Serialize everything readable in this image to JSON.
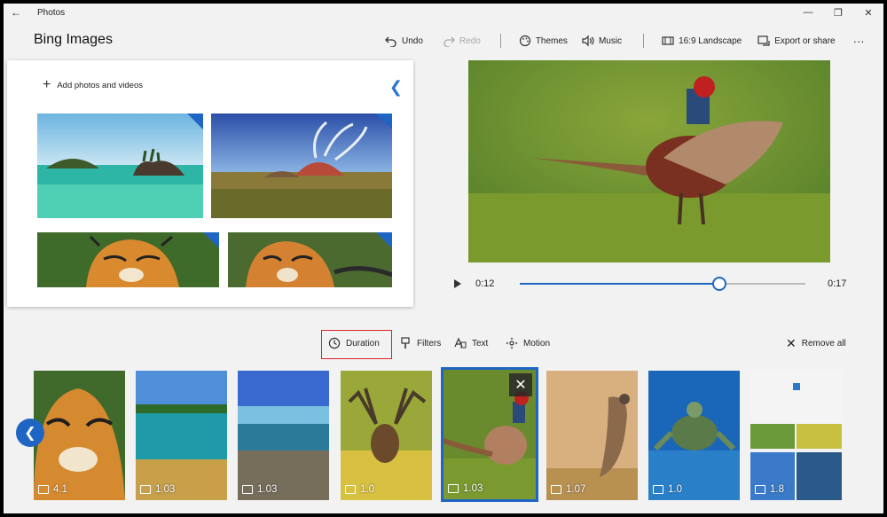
{
  "window": {
    "title": "Photos",
    "project_name": "Bing Images"
  },
  "toolbar": {
    "undo": "Undo",
    "redo": "Redo",
    "themes": "Themes",
    "music": "Music",
    "aspect": "16:9 Landscape",
    "export": "Export or share",
    "more": "···"
  },
  "library": {
    "add_label": "Add photos and videos"
  },
  "player": {
    "current_time": "0:12",
    "end_time": "0:17",
    "progress": 0.7
  },
  "storyboard": {
    "duration": "Duration",
    "filters": "Filters",
    "text": "Text",
    "motion": "Motion",
    "remove_all": "Remove all",
    "items": [
      {
        "duration": "4.1"
      },
      {
        "duration": "1.03"
      },
      {
        "duration": "1.03"
      },
      {
        "duration": "1.0"
      },
      {
        "duration": "1.03",
        "selected": true
      },
      {
        "duration": "1.07"
      },
      {
        "duration": "1.0"
      },
      {
        "duration": "1.8"
      }
    ]
  },
  "colors": {
    "accent": "#1f66c4",
    "highlight_box": "#e02020"
  }
}
